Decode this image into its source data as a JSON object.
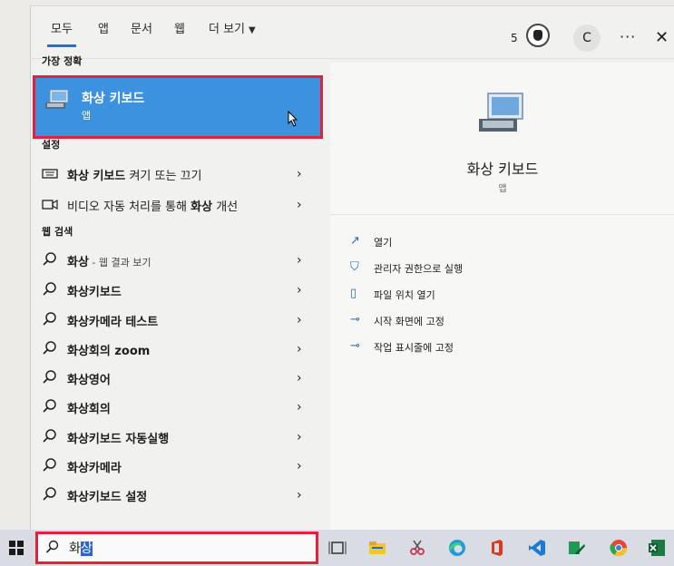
{
  "background": {
    "top_text": "..."
  },
  "tabs": [
    {
      "label": "모두"
    },
    {
      "label": "앱"
    },
    {
      "label": "문서"
    },
    {
      "label": "웹"
    },
    {
      "label": "더 보기"
    }
  ],
  "header": {
    "reward_count": "5",
    "avatar_letter": "C",
    "more_label": "···",
    "close_label": "✕"
  },
  "best_match": {
    "section_label": "가장 정확",
    "title": "화상 키보드",
    "subtitle": "앱"
  },
  "settings": {
    "section_label": "설정",
    "items": [
      {
        "pre": "",
        "bold": "화상 키보드",
        "post": " 켜기 또는 끄기"
      },
      {
        "pre": "비디오 자동 처리를 통해 ",
        "bold": "화상",
        "post": " 개선"
      }
    ]
  },
  "web": {
    "section_label": "웹 검색",
    "items": [
      {
        "bold": "화상",
        "post": " - 웹 결과 보기"
      },
      {
        "bold": "화상키보드",
        "post": ""
      },
      {
        "bold": "화상카메라 테스트",
        "post": ""
      },
      {
        "bold": "화상회의 zoom",
        "post": ""
      },
      {
        "bold": "화상영어",
        "post": ""
      },
      {
        "bold": "화상회의",
        "post": ""
      },
      {
        "bold": "화상키보드 자동실행",
        "post": ""
      },
      {
        "bold": "화상카메라",
        "post": ""
      },
      {
        "bold": "화상키보드 설정",
        "post": ""
      }
    ]
  },
  "detail": {
    "title": "화상 키보드",
    "subtitle": "앱",
    "actions": [
      {
        "label": "열기",
        "icon": "open-icon"
      },
      {
        "label": "관리자 권한으로 실행",
        "icon": "admin-shield-icon"
      },
      {
        "label": "파일 위치 열기",
        "icon": "file-location-icon"
      },
      {
        "label": "시작 화면에 고정",
        "icon": "pin-icon"
      },
      {
        "label": "작업 표시줄에 고정",
        "icon": "pin-icon"
      }
    ]
  },
  "taskbar": {
    "search_prefix": "화",
    "search_selected": "상"
  },
  "colors": {
    "accent": "#1a73d6",
    "highlight": "#3c92de",
    "annotation_red": "#e2213c"
  }
}
